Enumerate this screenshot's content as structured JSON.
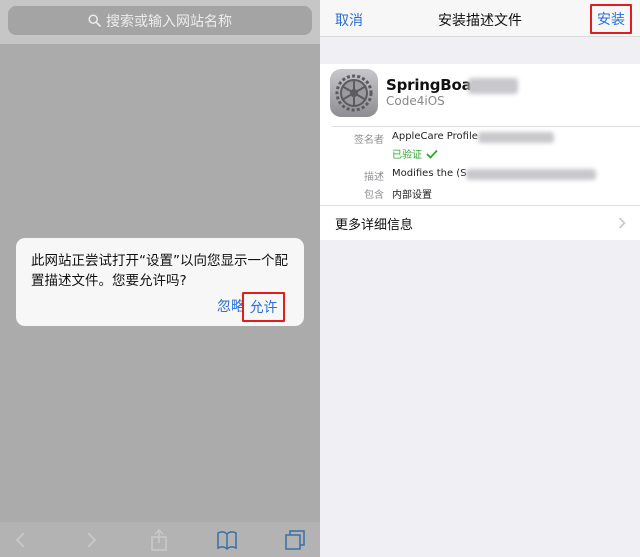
{
  "left": {
    "search_placeholder": "搜索或输入网站名称",
    "alert": {
      "message": "此网站正尝试打开“设置”以向您显示一个配置描述文件。您要允许吗?",
      "ignore_label": "忽略",
      "allow_label": "允许"
    },
    "toolbar_icons": [
      "back-icon",
      "forward-icon",
      "share-icon",
      "bookmarks-icon",
      "tabs-icon"
    ]
  },
  "right": {
    "nav": {
      "cancel_label": "取消",
      "title": "安装描述文件",
      "install_label": "安装"
    },
    "profile": {
      "name": "SpringBoar",
      "org": "Code4iOS",
      "signed_by_label": "签名者",
      "signed_by_value": "AppleCare Profile",
      "verified_text": "已验证",
      "description_label": "描述",
      "description_value": "Modifies the (S",
      "contains_label": "包含",
      "contains_value": "内部设置"
    },
    "more_details_label": "更多详细信息"
  },
  "colors": {
    "link_blue": "#2a6fd6",
    "highlight_red": "#e01e1e",
    "verified_green": "#2ca62c"
  }
}
